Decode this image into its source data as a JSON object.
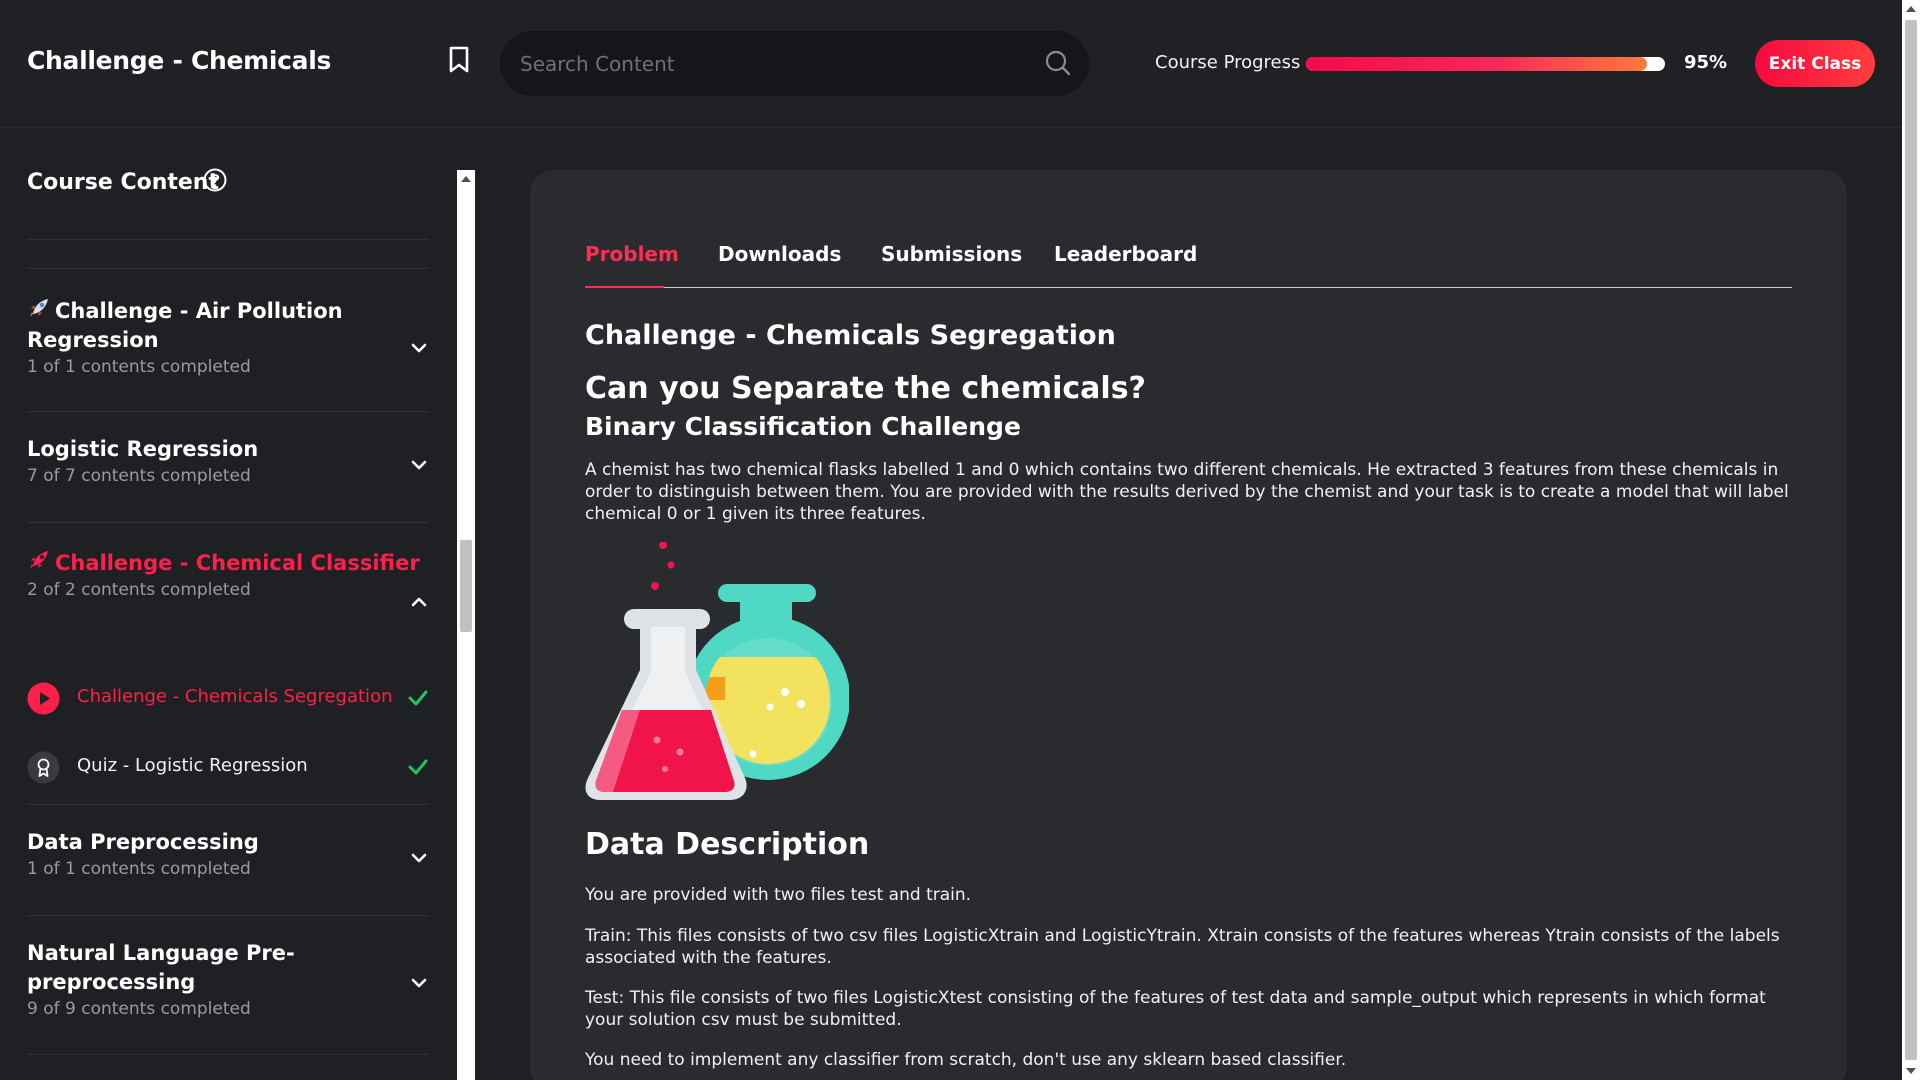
{
  "header": {
    "title": "Challenge - Chemicals",
    "search_placeholder": "Search Content",
    "progress_label": "Course Progress",
    "progress_percent_text": "95%",
    "progress_value": 0.95,
    "exit_label": "Exit Class"
  },
  "sidebar": {
    "title": "Course Content",
    "sections": [
      {
        "title": "Challenge - Air Pollution Regression",
        "meta": "1 of 1 contents completed"
      },
      {
        "title": "Logistic Regression",
        "meta": "7 of 7 contents completed"
      },
      {
        "title": "Challenge - Chemical Classifier",
        "meta": "2 of 2 contents completed"
      },
      {
        "title": "Data Preprocessing",
        "meta": "1 of 1 contents completed"
      },
      {
        "title": "Natural Language Pre-preprocessing",
        "meta": "9 of 9 contents completed"
      }
    ],
    "lessons": [
      {
        "label": "Challenge - Chemicals Segregation"
      },
      {
        "label": "Quiz - Logistic Regression"
      }
    ]
  },
  "tabs": [
    "Problem",
    "Downloads",
    "Submissions",
    "Leaderboard"
  ],
  "content": {
    "h1": "Challenge - Chemicals Segregation",
    "h2": "Can you Separate the chemicals?",
    "h3": "Binary Classification Challenge",
    "intro": "A chemist has two chemical flasks labelled 1 and 0 which contains two different chemicals. He extracted 3 features from these chemicals in order to distinguish between them. You are provided with the results derived by the chemist and your task is to create a model that will label chemical 0 or 1 given its three features.",
    "data_title": "Data Description",
    "p1": "You are provided with two files test and train.",
    "p2": "Train: This files consists of two csv files LogisticXtrain and LogisticYtrain. Xtrain consists of the features whereas Ytrain consists of the labels associated with the features.",
    "p3": "Test: This file consists of two files LogisticXtest consisting of the features of test data and sample_output which represents in which format your solution csv must be submitted.",
    "p4": "You need to implement any classifier from scratch, don't use any sklearn based classifier."
  },
  "colors": {
    "accent": "#ff2e52",
    "check": "#22c55e"
  }
}
